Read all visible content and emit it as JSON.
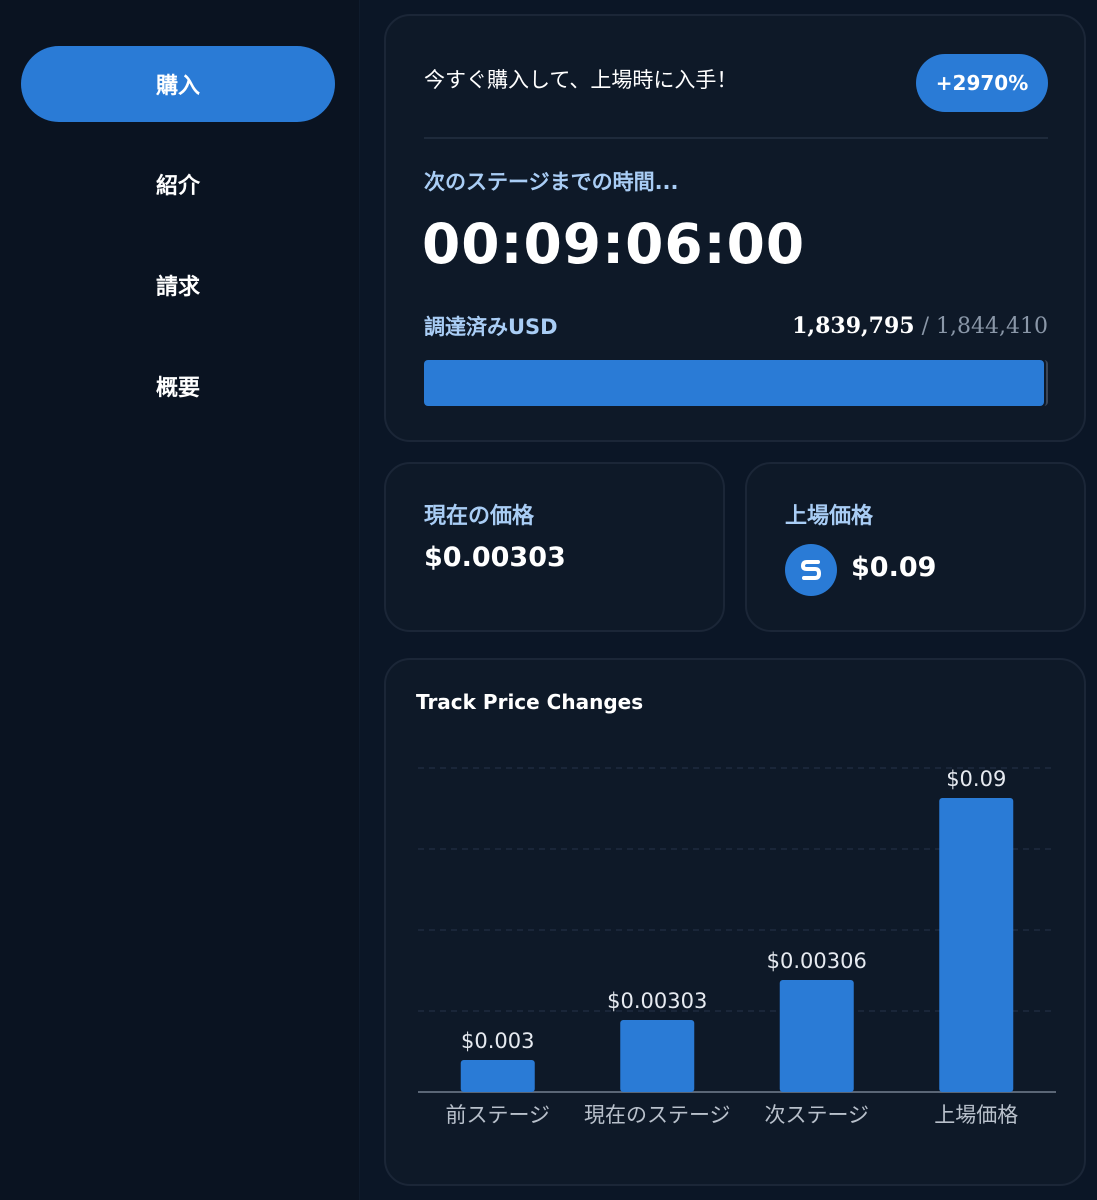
{
  "sidebar": {
    "items": [
      {
        "label": "購入",
        "active": true
      },
      {
        "label": "紹介",
        "active": false
      },
      {
        "label": "請求",
        "active": false
      },
      {
        "label": "概要",
        "active": false
      }
    ]
  },
  "presale": {
    "promo": "今すぐ購入して、上場時に入手！",
    "badge": "+2970%",
    "stage_label": "次のステージまでの時間...",
    "timer": "00:09:06:00",
    "raised_label": "調達済みUSD",
    "raised": "1,839,795",
    "separator": "/",
    "goal": "1,844,410",
    "progress_fraction": 0.9975
  },
  "current_price": {
    "label": "現在の価格",
    "value": "$0.00303"
  },
  "listing_price": {
    "label": "上場価格",
    "value": "$0.09",
    "icon": "token-s-icon"
  },
  "colors": {
    "accent": "#2a7bd6",
    "label": "#a9cdf5"
  },
  "chart_data": {
    "type": "bar",
    "title": "Track Price Changes",
    "categories": [
      "前ステージ",
      "現在のステージ",
      "次ステージ",
      "上場価格"
    ],
    "values": [
      0.003,
      0.00303,
      0.00306,
      0.09
    ],
    "data_labels": [
      "$0.003",
      "$0.00303",
      "$0.00306",
      "$0.09"
    ],
    "grid": true,
    "xlabel": "",
    "ylabel": ""
  }
}
